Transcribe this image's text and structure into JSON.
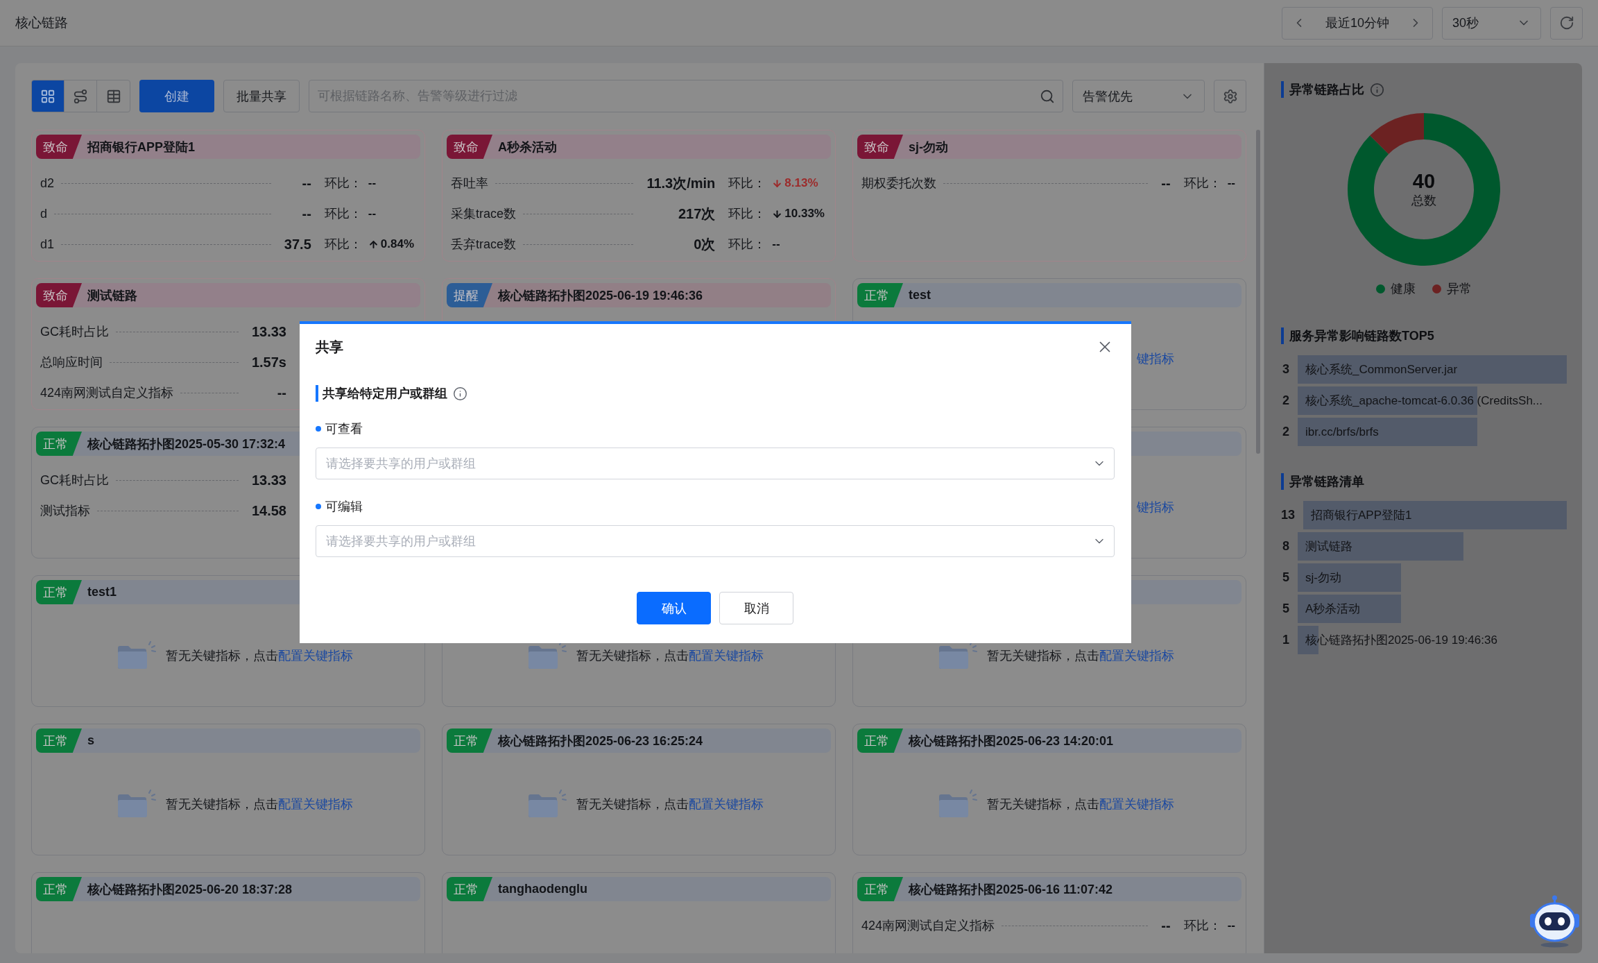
{
  "page_header": {
    "title": "核心链路",
    "time_range": "最近10分钟",
    "interval": "30秒"
  },
  "toolbar": {
    "views": [
      {
        "kind": "grid",
        "selected": true
      },
      {
        "kind": "route",
        "selected": false
      },
      {
        "kind": "table",
        "selected": false
      }
    ],
    "create": "创建",
    "batch_share": "批量共享",
    "search": {
      "placeholder": "可根据链路名称、告警等级进行过滤"
    },
    "sort": "告警优先"
  },
  "cards": [
    {
      "badge": "致命",
      "kind": "critical",
      "title": "招商银行APP登陆1",
      "metrics": [
        {
          "name": "d2",
          "value": "--",
          "change_label": "环比：",
          "change": "--"
        },
        {
          "name": "d",
          "value": "--",
          "change_label": "环比：",
          "change": "--"
        },
        {
          "name": "d1",
          "value": "37.5",
          "change_label": "环比：",
          "change": "0.84%",
          "rising": true,
          "alert": false
        }
      ]
    },
    {
      "badge": "致命",
      "kind": "critical",
      "title": "A秒杀活动",
      "metrics": [
        {
          "name": "吞吐率",
          "value": "11.3次/min",
          "change_label": "环比：",
          "change": "8.13%",
          "rising": false,
          "alert": true
        },
        {
          "name": "采集trace数",
          "value": "217次",
          "change_label": "环比：",
          "change": "10.33%",
          "rising": false,
          "alert": false
        },
        {
          "name": "丢弃trace数",
          "value": "0次",
          "change_label": "环比：",
          "change": "--"
        }
      ]
    },
    {
      "badge": "致命",
      "kind": "critical",
      "title": "sj-勿动",
      "metrics": [
        {
          "name": "期权委托次数",
          "value": "--",
          "change_label": "环比：",
          "change": "--"
        }
      ]
    },
    {
      "badge": "致命",
      "kind": "critical",
      "title": "测试链路",
      "metrics": [
        {
          "name": "GC耗时占比",
          "value": "13.33"
        },
        {
          "name": "总响应时间",
          "value": "1.57s"
        },
        {
          "name": "424南网测试自定义指标",
          "value": "--"
        }
      ]
    },
    {
      "badge": "提醒",
      "kind": "warning",
      "title": "核心链路拓扑图2025-06-19 19:46:36"
    },
    {
      "badge": "正常",
      "kind": "normal",
      "title": "test",
      "empty_state": {
        "link": "键指标"
      }
    },
    {
      "badge": "正常",
      "kind": "normal",
      "title": "核心链路拓扑图2025-05-30 17:32:4",
      "metrics": [
        {
          "name": "GC耗时占比",
          "value": "13.33"
        },
        {
          "name": "测试指标",
          "value": "14.58"
        }
      ]
    },
    {
      "kind": "normal",
      "empty_state": {
        "link": "键指标"
      }
    },
    {
      "badge": "正常",
      "kind": "normal",
      "title": "test1",
      "empty_state": {
        "text": "暂无关键指标，点击",
        "link": "配置关键指标"
      }
    },
    {
      "kind": "normal",
      "empty_state": {
        "text": "暂无关键指标，点击",
        "link": "配置关键指标"
      }
    },
    {
      "kind": "normal",
      "empty_state": {
        "text": "暂无关键指标，点击",
        "link": "配置关键指标"
      }
    },
    {
      "badge": "正常",
      "kind": "normal",
      "title": "s",
      "empty_state": {
        "text": "暂无关键指标，点击",
        "link": "配置关键指标"
      }
    },
    {
      "badge": "正常",
      "kind": "normal",
      "title": "核心链路拓扑图2025-06-23 16:25:24",
      "empty_state": {
        "text": "暂无关键指标，点击",
        "link": "配置关键指标"
      }
    },
    {
      "badge": "正常",
      "kind": "normal",
      "title": "核心链路拓扑图2025-06-23 14:20:01",
      "empty_state": {
        "text": "暂无关键指标，点击",
        "link": "配置关键指标"
      }
    },
    {
      "badge": "正常",
      "kind": "normal",
      "title": "核心链路拓扑图2025-06-20 18:37:28"
    },
    {
      "badge": "正常",
      "kind": "normal",
      "title": "tanghaodenglu"
    },
    {
      "badge": "正常",
      "kind": "normal",
      "title": "核心链路拓扑图2025-06-16 11:07:42",
      "metrics": [
        {
          "name": "424南网测试自定义指标",
          "value": "--",
          "change_label": "环比：",
          "change": "--"
        }
      ]
    }
  ],
  "sidebar": {
    "ratio": {
      "title": "异常链路占比",
      "total": "40",
      "total_label": "总数",
      "legend": [
        {
          "label": "健康",
          "color": "#00582d"
        },
        {
          "label": "异常",
          "color": "#6c2222"
        }
      ]
    },
    "top_services": {
      "title": "服务异常影响链路数TOP5",
      "items": [
        {
          "count": "3",
          "name": "核心系统_CommonServer.jar",
          "level": 1
        },
        {
          "count": "2",
          "name": "核心系统_apache-tomcat-6.0.36 (CreditsSh...",
          "level": 0.667
        },
        {
          "count": "2",
          "name": "ibr.cc/brfs/brfs",
          "level": 0.667
        }
      ]
    },
    "abnormal_links": {
      "title": "异常链路清单",
      "items": [
        {
          "count": "13",
          "name": "招商银行APP登陆1",
          "level": 1
        },
        {
          "count": "8",
          "name": "测试链路",
          "level": 0.615
        },
        {
          "count": "5",
          "name": "sj-勿动",
          "level": 0.385
        },
        {
          "count": "5",
          "name": "A秒杀活动",
          "level": 0.385
        },
        {
          "count": "1",
          "name": "核心链路拓扑图2025-06-19 19:46:36",
          "level": 0.077
        }
      ]
    }
  },
  "dialog": {
    "title": "共享",
    "section": "共享给特定用户或群组",
    "fields": [
      {
        "label": "可查看",
        "placeholder": "请选择要共享的用户或群组"
      },
      {
        "label": "可编辑",
        "placeholder": "请选择要共享的用户或群组"
      }
    ],
    "buttons": [
      {
        "label": "确认",
        "kind": "primary"
      },
      {
        "label": "取消",
        "kind": "default"
      }
    ]
  }
}
